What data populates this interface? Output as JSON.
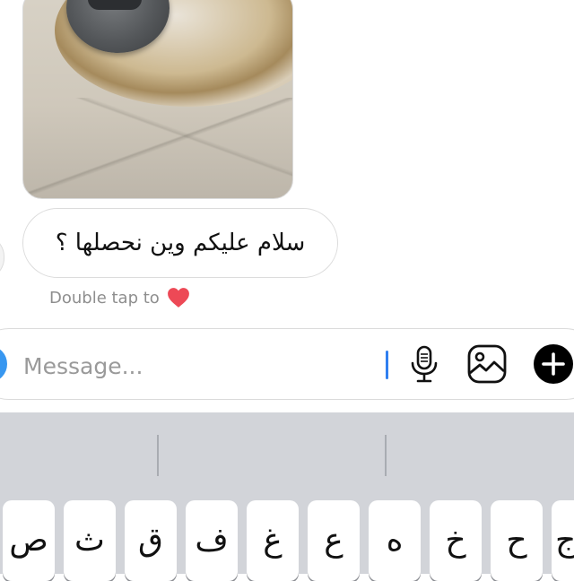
{
  "chat": {
    "incoming_message": "سلام عليكم وين نحصلها ؟",
    "hint": "Double tap to"
  },
  "composer": {
    "placeholder": "Message..."
  },
  "keyboard": {
    "row1": [
      "ص",
      "ث",
      "ق",
      "ف",
      "غ",
      "ع",
      "ه",
      "خ",
      "ح",
      "ج"
    ]
  },
  "icons": {
    "heart": "heart-icon",
    "mic": "microphone-icon",
    "gallery": "gallery-icon",
    "plus": "plus-circle-icon",
    "camera": "camera-icon"
  },
  "colors": {
    "heart": "#ed4956",
    "camera_button": "#3897f0",
    "caret": "#2f7ff0",
    "keyboard_bg": "#d2d4d9"
  }
}
